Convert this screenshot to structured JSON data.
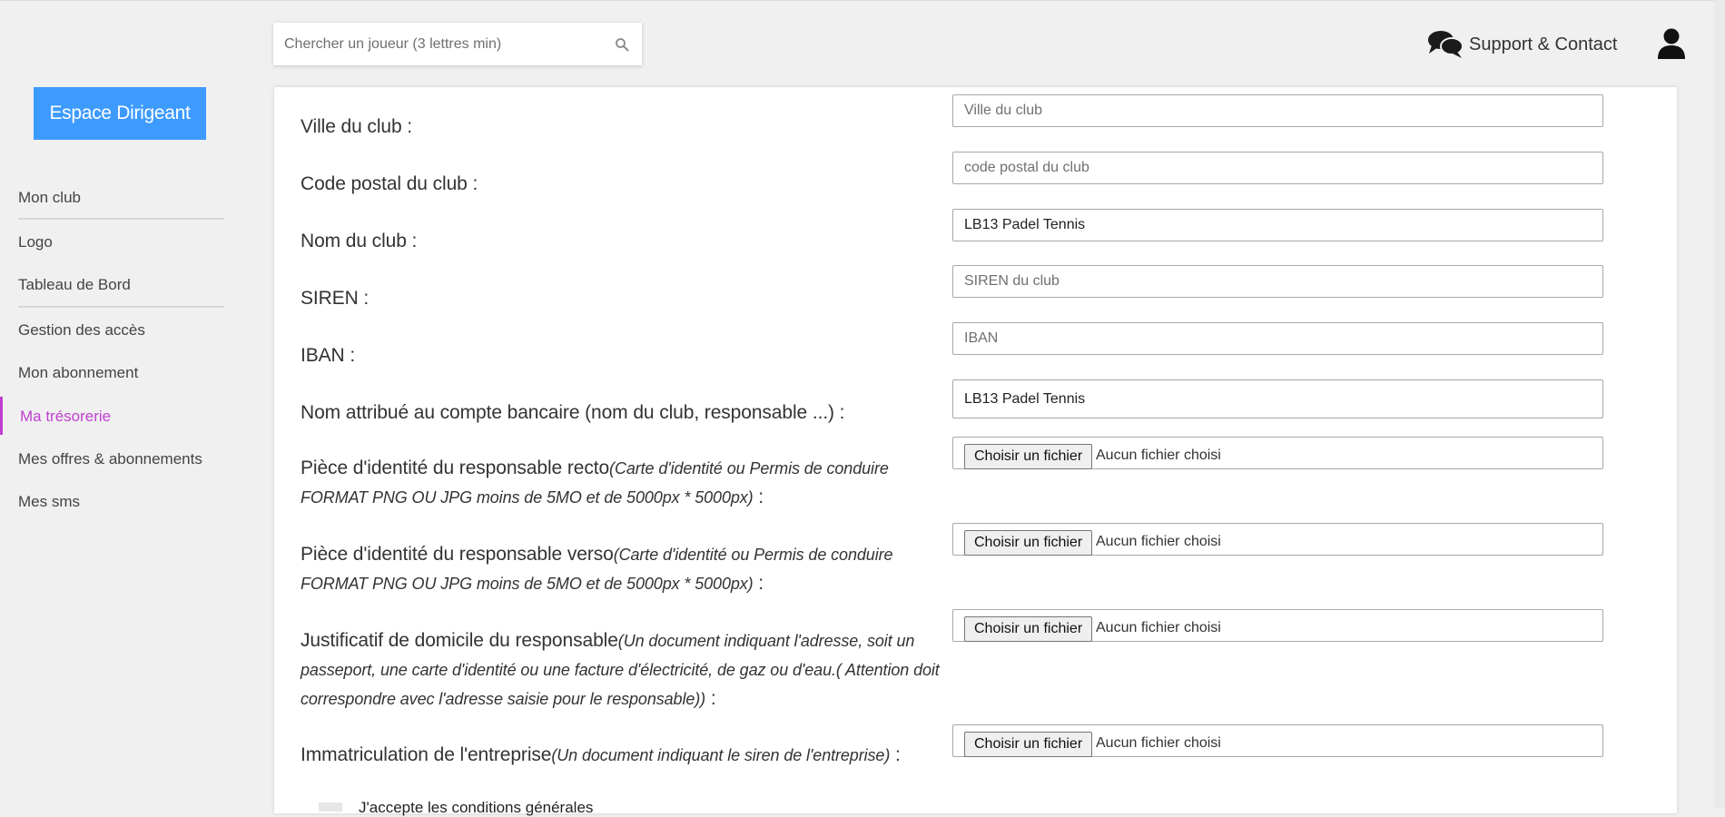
{
  "search": {
    "placeholder": "Chercher un joueur (3 lettres min)"
  },
  "header": {
    "support_label": "Support & Contact"
  },
  "sidebar": {
    "espace_label": "Espace Dirigeant",
    "items": [
      {
        "label": "Mon club"
      },
      {
        "label": "Logo"
      },
      {
        "label": "Tableau de Bord"
      },
      {
        "label": "Gestion des accès"
      },
      {
        "label": "Mon abonnement"
      },
      {
        "label": "Ma trésorerie",
        "active": true
      },
      {
        "label": "Mes offres & abonnements"
      },
      {
        "label": "Mes sms"
      }
    ]
  },
  "form": {
    "ville": {
      "label": "Ville du club :",
      "placeholder": "Ville du club",
      "value": ""
    },
    "code_postal": {
      "label": "Code postal du club :",
      "placeholder": "code postal du club",
      "value": ""
    },
    "nom": {
      "label": "Nom du club :",
      "placeholder": "",
      "value": "LB13 Padel Tennis"
    },
    "siren": {
      "label": "SIREN :",
      "placeholder": "SIREN du club",
      "value": ""
    },
    "iban": {
      "label": "IBAN :",
      "placeholder": "IBAN",
      "value": ""
    },
    "compte": {
      "label": "Nom attribué au compte bancaire (nom du club, responsable ...) :",
      "placeholder": "",
      "value": "LB13 Padel Tennis"
    },
    "file_button_label": "Choisir un fichier",
    "file_status": "Aucun fichier choisi",
    "piece_recto": {
      "label": "Pièce d'identité du responsable recto",
      "hint": "(Carte d'identité ou Permis de conduire FORMAT PNG OU JPG moins de 5MO et de 5000px * 5000px)",
      "suffix": " :"
    },
    "piece_verso": {
      "label": "Pièce d'identité du responsable verso",
      "hint": "(Carte d'identité ou Permis de conduire FORMAT PNG OU JPG moins de 5MO et de 5000px * 5000px)",
      "suffix": " :"
    },
    "justificatif": {
      "label": "Justificatif de domicile du responsable",
      "hint": "(Un document indiquant l'adresse, soit un passeport, une carte d'identité ou une facture d'électricité, de gaz ou d'eau.( Attention doit correspondre avec l'adresse saisie pour le responsable))",
      "suffix": " :"
    },
    "immatriculation": {
      "label": "Immatriculation de l'entreprise",
      "hint": "(Un document indiquant le siren de l'entreprise)",
      "suffix": " :"
    },
    "cgu_label": "J'accepte les conditions générales"
  }
}
